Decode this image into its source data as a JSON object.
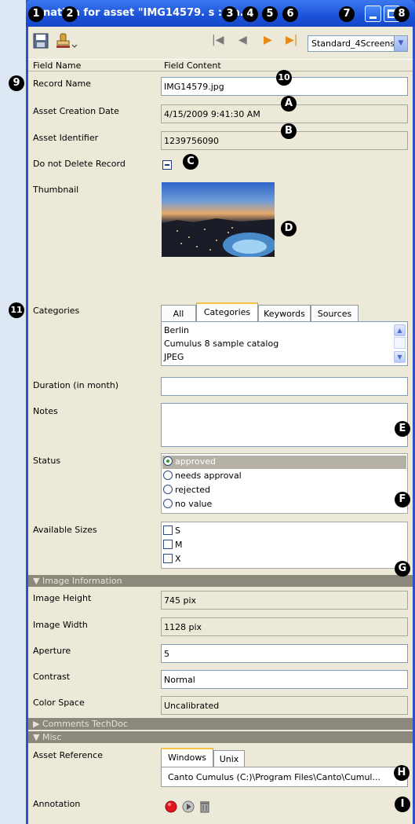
{
  "window": {
    "title": "Information for asset \"IMG14579.jpg\" - Status : Sa...",
    "title_shown": "nation for asset \"IMG14579.     s : Sa..",
    "colors": {
      "titlebar": "#1b52d8",
      "client": "#ece9d8",
      "section": "#8c887c",
      "selected": "#b4b0a4"
    }
  },
  "toolbar": {
    "save_icon": "save-icon",
    "stamp_icon": "stamp-icon",
    "first_glyph": "|◀",
    "prev_glyph": "◀",
    "next_glyph": "▶",
    "last_glyph": "▶|",
    "preset": "Standard_4Screens"
  },
  "columns": {
    "name": "Field Name",
    "content": "Field Content"
  },
  "fields": {
    "record_name": {
      "label": "Record Name",
      "value": "IMG14579.jpg"
    },
    "creation_date": {
      "label": "Asset Creation Date",
      "value": "4/15/2009 9:41:30 AM"
    },
    "identifier": {
      "label": "Asset Identifier",
      "value": "1239756090"
    },
    "do_not_delete": {
      "label": "Do not Delete Record",
      "state": "indeterminate"
    },
    "thumbnail": {
      "label": "Thumbnail"
    },
    "categories": {
      "label": "Categories",
      "tabs": [
        "All",
        "Categories",
        "Keywords",
        "Sources"
      ],
      "active_tab": "Categories",
      "items": [
        "Berlin",
        "Cumulus 8 sample catalog",
        "JPEG"
      ]
    },
    "duration": {
      "label": "Duration (in month)",
      "value": ""
    },
    "notes": {
      "label": "Notes",
      "value": ""
    },
    "status": {
      "label": "Status",
      "options": [
        "approved",
        "needs approval",
        "rejected",
        "no value"
      ],
      "selected": "approved"
    },
    "sizes": {
      "label": "Available Sizes",
      "options": [
        "S",
        "M",
        "X"
      ]
    }
  },
  "sections": {
    "image_info": "▼ Image Information",
    "comments": "▶ Comments TechDoc",
    "misc": "▼ Misc"
  },
  "image_info": {
    "height": {
      "label": "Image Height",
      "value": "745 pix"
    },
    "width": {
      "label": "Image Width",
      "value": "1128 pix"
    },
    "aperture": {
      "label": "Aperture",
      "value": "5"
    },
    "contrast": {
      "label": "Contrast",
      "value": "Normal"
    },
    "color_space": {
      "label": "Color Space",
      "value": "Uncalibrated"
    }
  },
  "misc": {
    "asset_reference": {
      "label": "Asset Reference",
      "tabs": [
        "Windows",
        "Unix"
      ],
      "active_tab": "Windows",
      "value": "Canto Cumulus (C:)\\Program Files\\Canto\\Cumul..."
    },
    "annotation": {
      "label": "Annotation",
      "icons": [
        "record-icon",
        "play-icon",
        "trash-icon"
      ]
    }
  },
  "markers": {
    "m1": "1",
    "m2": "2",
    "m3": "3",
    "m4": "4",
    "m5": "5",
    "m6": "6",
    "m7": "7",
    "m8": "8",
    "m9": "9",
    "m10": "10",
    "m11": "11",
    "mA": "A",
    "mB": "B",
    "mC": "C",
    "mD": "D",
    "mE": "E",
    "mF": "F",
    "mG": "G",
    "mH": "H",
    "mI": "I"
  }
}
